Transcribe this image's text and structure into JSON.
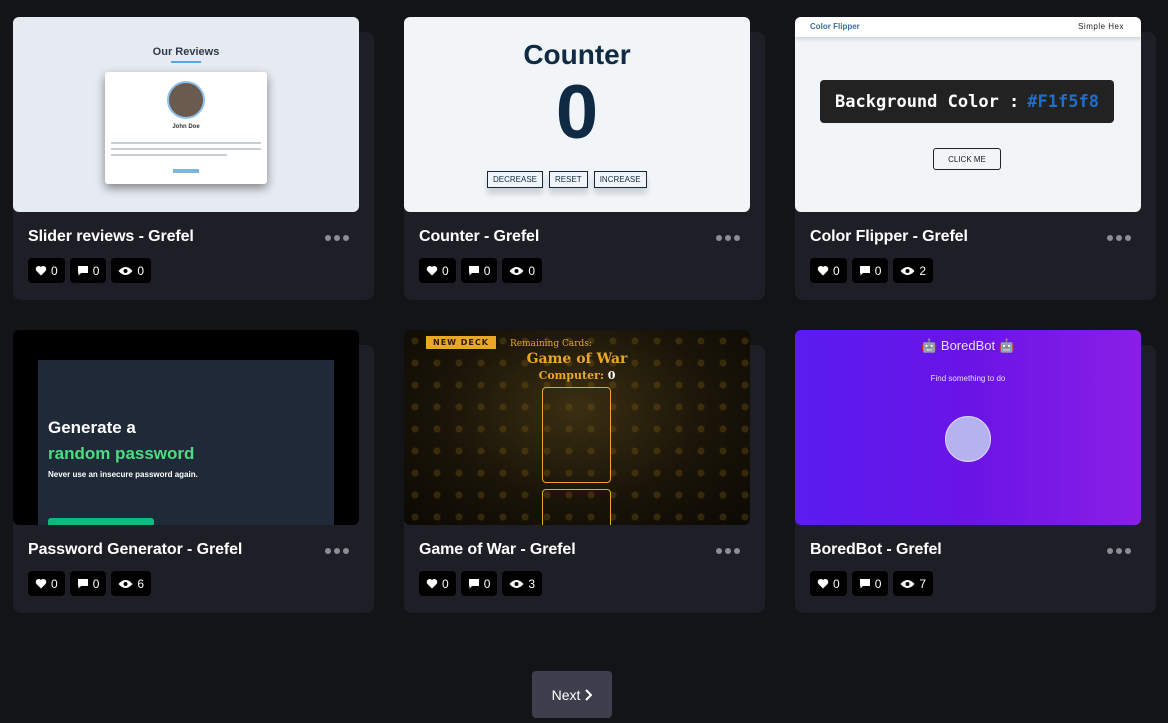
{
  "projects": [
    {
      "title": "Slider reviews - Grefel",
      "likes": "0",
      "comments": "0",
      "views": "0",
      "thumb": {
        "heading": "Our Reviews",
        "name": "John Doe"
      }
    },
    {
      "title": "Counter - Grefel",
      "likes": "0",
      "comments": "0",
      "views": "0",
      "thumb": {
        "heading": "Counter",
        "value": "0",
        "buttons": [
          "DECREASE",
          "RESET",
          "INCREASE"
        ]
      }
    },
    {
      "title": "Color Flipper - Grefel",
      "likes": "0",
      "comments": "0",
      "views": "2",
      "thumb": {
        "nav_left": "Color Flipper",
        "nav_right": "Simple Hex",
        "label": "Background Color :",
        "hex": "#F1f5f8",
        "button": "CLICK ME"
      }
    },
    {
      "title": "Password Generator - Grefel",
      "likes": "0",
      "comments": "0",
      "views": "6",
      "thumb": {
        "line1": "Generate a",
        "line2": "random password",
        "line3": "Never use an insecure password again."
      }
    },
    {
      "title": "Game of War - Grefel",
      "likes": "0",
      "comments": "0",
      "views": "3",
      "thumb": {
        "badge": "NEW DECK",
        "remaining": "Remaining Cards:",
        "heading": "Game of War",
        "computer_label": "Computer:",
        "computer_score": "0"
      }
    },
    {
      "title": "BoredBot - Grefel",
      "likes": "0",
      "comments": "0",
      "views": "7",
      "thumb": {
        "heading": "🤖 BoredBot 🤖",
        "sub": "Find something to do"
      }
    }
  ],
  "pagination": {
    "next_label": "Next"
  },
  "colors": {
    "background": "#131417",
    "card": "#1e1f26",
    "button": "#3d3f4d"
  },
  "icons": {
    "likes": "heart-icon",
    "comments": "comment-icon",
    "views": "eye-icon",
    "more": "ellipsis-icon",
    "next": "chevron-right-icon"
  }
}
